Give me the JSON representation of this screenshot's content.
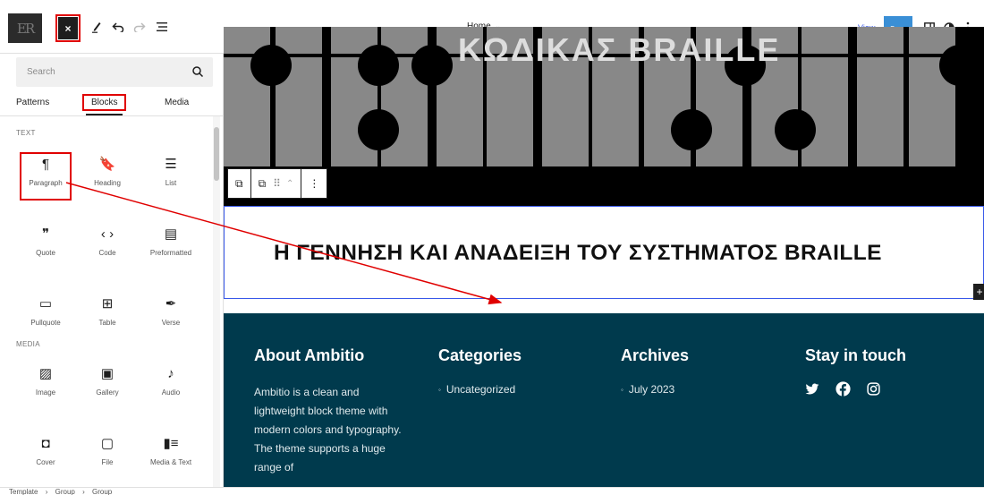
{
  "topbar": {
    "site_logo_text": "ER",
    "close_label": "×",
    "doc_title": "Home",
    "view_label": "View",
    "save_label": "Save",
    "icons": [
      "pen-icon",
      "undo-icon",
      "redo-icon",
      "list-view-icon",
      "sidebar-toggle-icon",
      "contrast-icon",
      "more-vertical-icon"
    ]
  },
  "inserter": {
    "search_placeholder": "Search",
    "tabs": [
      {
        "label": "Patterns"
      },
      {
        "label": "Blocks"
      },
      {
        "label": "Media"
      }
    ],
    "active_tab": "Blocks",
    "sections": [
      {
        "title": "TEXT",
        "blocks": [
          {
            "label": "Paragraph",
            "icon": "¶",
            "icon_name": "paragraph-icon"
          },
          {
            "label": "Heading",
            "icon": "🔖",
            "icon_name": "heading-icon"
          },
          {
            "label": "List",
            "icon": "☰",
            "icon_name": "list-icon"
          },
          {
            "label": "Quote",
            "icon": "❞",
            "icon_name": "quote-icon"
          },
          {
            "label": "Code",
            "icon": "‹ ›",
            "icon_name": "code-icon"
          },
          {
            "label": "Preformatted",
            "icon": "▤",
            "icon_name": "preformatted-icon"
          },
          {
            "label": "Pullquote",
            "icon": "▭",
            "icon_name": "pullquote-icon"
          },
          {
            "label": "Table",
            "icon": "⊞",
            "icon_name": "table-icon"
          },
          {
            "label": "Verse",
            "icon": "✒",
            "icon_name": "verse-icon"
          }
        ]
      },
      {
        "title": "MEDIA",
        "blocks": [
          {
            "label": "Image",
            "icon": "▨",
            "icon_name": "image-icon"
          },
          {
            "label": "Gallery",
            "icon": "▣",
            "icon_name": "gallery-icon"
          },
          {
            "label": "Audio",
            "icon": "♪",
            "icon_name": "audio-icon"
          },
          {
            "label": "Cover",
            "icon": "◘",
            "icon_name": "cover-icon"
          },
          {
            "label": "File",
            "icon": "▢",
            "icon_name": "file-icon"
          },
          {
            "label": "Media & Text",
            "icon": "▮≡",
            "icon_name": "media-text-icon"
          }
        ]
      }
    ],
    "selected_block": "Paragraph"
  },
  "canvas": {
    "braille_image_title": "ΚΩΔΙΚΑΣ BRAILLE",
    "heading": "Η ΓΕΝΝΗΣΗ ΚΑΙ ΑΝΑΔΕΙΞΗ ΤΟΥ ΣΥΣΤΗΜΑΤΟΣ BRAILLE",
    "footer": {
      "about_title": "About Ambitio",
      "about_text": "Ambitio is a clean and lightweight block theme with modern colors and typography. The theme supports a huge range of",
      "categories_title": "Categories",
      "categories": [
        "Uncategorized"
      ],
      "archives_title": "Archives",
      "archives": [
        "July 2023"
      ],
      "social_title": "Stay in touch",
      "social_icons": [
        "twitter-icon",
        "facebook-icon",
        "instagram-icon"
      ]
    }
  },
  "breadcrumb": {
    "items": [
      "Template",
      "Group",
      "Group"
    ],
    "separator": "›"
  },
  "colors": {
    "accent": "#3858e9",
    "save": "#3a8fd6",
    "footer_bg": "#003a4d",
    "annotation": "#e00000"
  }
}
